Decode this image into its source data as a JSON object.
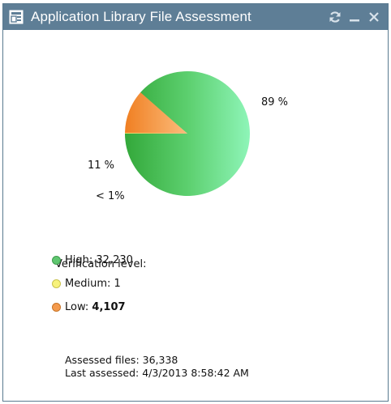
{
  "window": {
    "title": "Application Library File Assessment",
    "title_icon": "app-library-icon",
    "controls": [
      "refresh-icon",
      "minimize-icon",
      "close-icon"
    ]
  },
  "chart_data": {
    "type": "pie",
    "slices": [
      {
        "name": "High",
        "value": 32230,
        "percent_label": "89 %",
        "color": "#5ccf6e"
      },
      {
        "name": "Medium",
        "value": 1,
        "percent_label": "< 1%",
        "color": "#f4f07a"
      },
      {
        "name": "Low",
        "value": 4107,
        "percent_label": "11 %",
        "color": "#f59a4a"
      }
    ]
  },
  "legend": {
    "title": "Verification level:",
    "items": [
      {
        "label": "High:",
        "value": "32,230",
        "color": "#5fc670"
      },
      {
        "label": "Medium:",
        "value": "1",
        "color": "#f7f27c"
      },
      {
        "label": "Low:",
        "value": "4,107",
        "color": "#f49a4c"
      }
    ]
  },
  "footer": {
    "assessed_label": "Assessed files:",
    "assessed_value": "36,338",
    "last_label": "Last assessed:",
    "last_value": "4/3/2013 8:58:42 AM"
  }
}
